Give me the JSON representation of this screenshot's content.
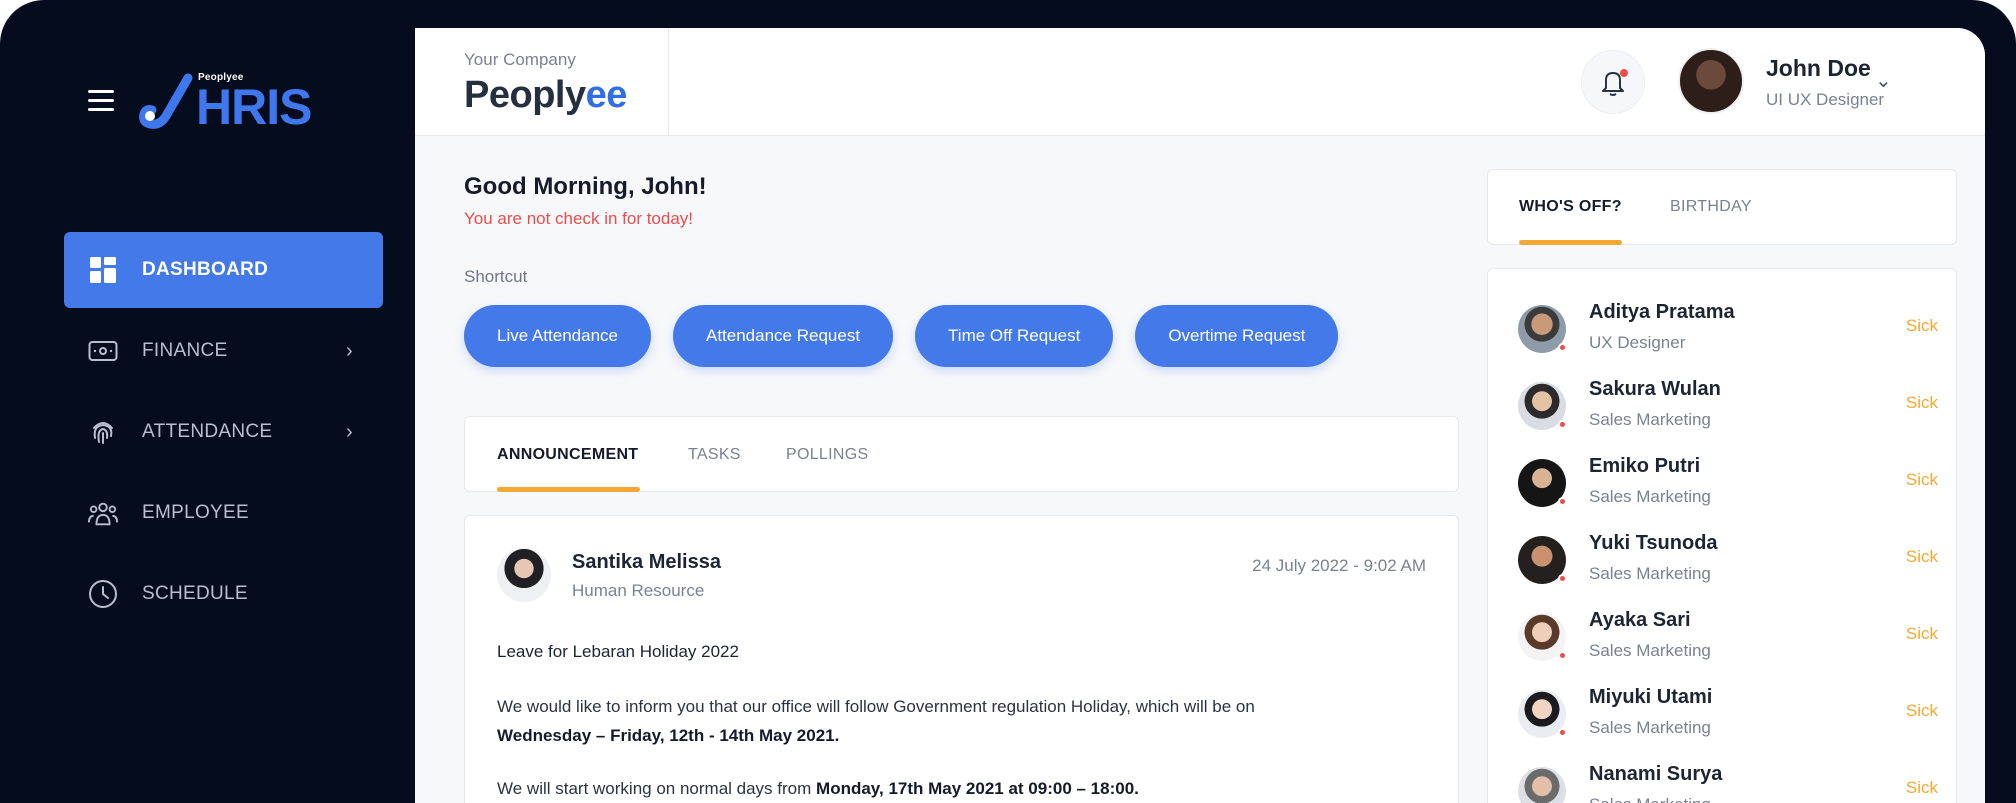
{
  "brand": {
    "small": "Peoplyee",
    "name": "HRIS"
  },
  "sidebar": {
    "items": [
      {
        "label": "DASHBOARD",
        "icon": "dashboard-icon",
        "active": true
      },
      {
        "label": "FINANCE",
        "icon": "wallet-icon"
      },
      {
        "label": "ATTENDANCE",
        "icon": "fingerprint-icon"
      },
      {
        "label": "EMPLOYEE",
        "icon": "people-icon"
      },
      {
        "label": "SCHEDULE",
        "icon": "clock-icon"
      }
    ]
  },
  "header": {
    "company_sub": "Your Company",
    "company_name_a": "Peoply",
    "company_name_b": "ee",
    "user": {
      "name": "John Doe",
      "role": "UI UX Designer"
    }
  },
  "main": {
    "greeting": "Good Morning, John!",
    "warning": "You are not check in for today!",
    "shortcut_title": "Shortcut",
    "shortcuts": [
      "Live Attendance",
      "Attendance Request",
      "Time Off Request",
      "Overtime Request"
    ],
    "tabs": [
      "ANNOUNCEMENT",
      "TASKS",
      "POLLINGS"
    ],
    "post": {
      "author": "Santika Melissa",
      "department": "Human Resource",
      "date": "24 July 2022 - 9:02 AM",
      "title": "Leave for Lebaran Holiday 2022",
      "p1_a": "We would like to inform you that our office will follow Government regulation Holiday, which will be on",
      "p1_b": "Wednesday – Friday, 12th - 14th May 2021.",
      "p2_a": "We will start working on normal days from",
      "p2_b": "Monday, 17th May 2021 at 09:00 – 18:00."
    }
  },
  "side": {
    "tabs": [
      "WHO'S OFF?",
      "BIRTHDAY"
    ],
    "off": [
      {
        "name": "Aditya Pratama",
        "role": "UX Designer",
        "status": "Sick"
      },
      {
        "name": "Sakura Wulan",
        "role": "Sales Marketing",
        "status": "Sick"
      },
      {
        "name": "Emiko Putri",
        "role": "Sales Marketing",
        "status": "Sick"
      },
      {
        "name": "Yuki Tsunoda",
        "role": "Sales Marketing",
        "status": "Sick"
      },
      {
        "name": "Ayaka Sari",
        "role": "Sales Marketing",
        "status": "Sick"
      },
      {
        "name": "Miyuki Utami",
        "role": "Sales Marketing",
        "status": "Sick"
      },
      {
        "name": "Nanami Surya",
        "role": "Sales Marketing",
        "status": "Sick"
      }
    ]
  },
  "colors": {
    "primary": "#4479e9",
    "accent": "#f4a831",
    "danger": "#ef4b4b",
    "sidebar_bg": "#050c1e"
  }
}
